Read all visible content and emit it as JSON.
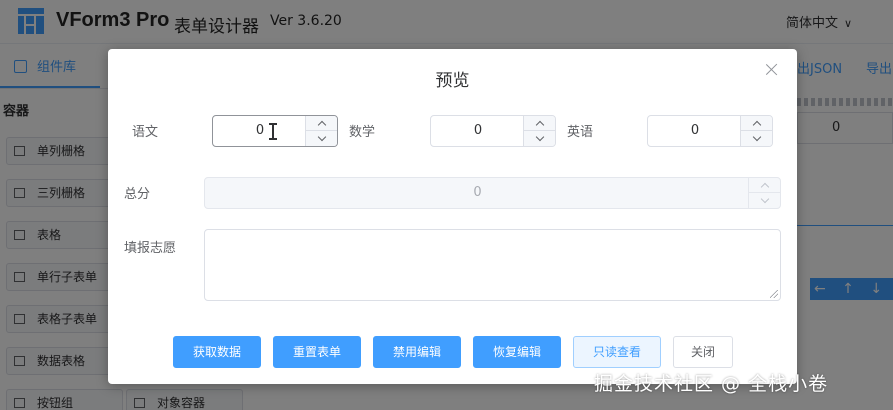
{
  "app": {
    "title": "VForm3 Pro",
    "subtitle": "表单设计器",
    "version": "Ver 3.6.20",
    "language": "简体中文"
  },
  "left_panel": {
    "tab_label": "组件库",
    "category_title": "容器",
    "widgets": [
      "单列栅格",
      "三列栅格",
      "表格",
      "单行子表单",
      "表格子表单",
      "数据表格",
      "按钮组",
      "对象容器"
    ]
  },
  "toolbar_right": {
    "export_json_label": "出JSON",
    "export_label": "导出",
    "field_value": "0",
    "nav_arrows": "← ↑ ↓ ⧉"
  },
  "dialog": {
    "title": "预览",
    "fields": {
      "chinese": {
        "label": "语文",
        "value": "0"
      },
      "math": {
        "label": "数学",
        "value": "0"
      },
      "english": {
        "label": "英语",
        "value": "0"
      },
      "total": {
        "label": "总分",
        "value": "0"
      },
      "aspiration": {
        "label": "填报志愿",
        "value": ""
      }
    },
    "buttons": {
      "get_data": "获取数据",
      "reset_form": "重置表单",
      "disable_edit": "禁用编辑",
      "restore_edit": "恢复编辑",
      "readonly_view": "只读查看",
      "close": "关闭"
    }
  },
  "watermark": "掘金技术社区 @ 全栈小卷",
  "colors": {
    "primary": "#409eff",
    "overlay": "rgba(0,0,0,0.5)",
    "disabled_bg": "#f5f7fa"
  }
}
